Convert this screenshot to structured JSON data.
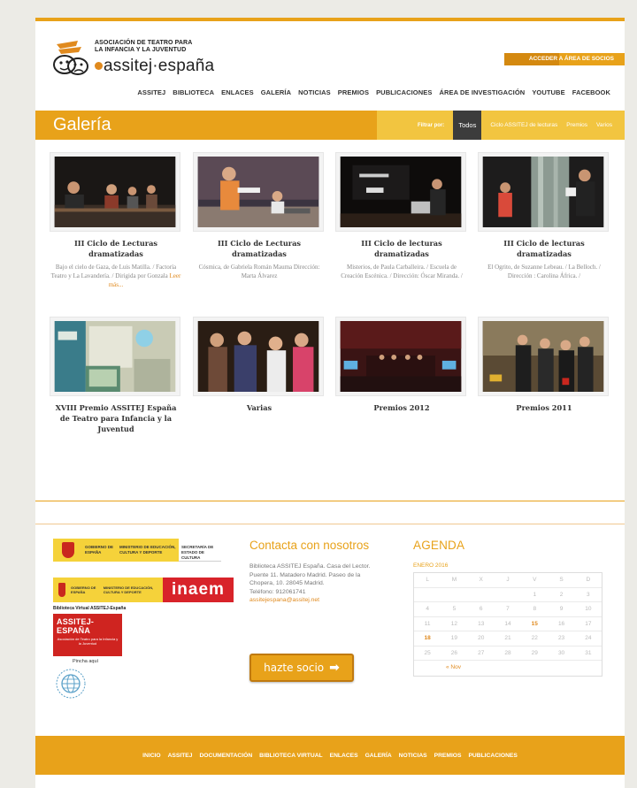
{
  "header": {
    "org_line1": "ASOCIACIÓN DE TEATRO PARA",
    "org_line2": "LA INFANCIA Y LA JUVENTUD",
    "brand": "assitej·españa",
    "members_button": "ACCEDER A ÁREA DE SOCIOS",
    "nav": [
      "ASSITEJ",
      "BIBLIOTECA",
      "ENLACES",
      "GALERÍA",
      "NOTICIAS",
      "PREMIOS",
      "PUBLICACIONES",
      "ÁREA DE INVESTIGACIÓN",
      "YOUTUBE",
      "FACEBOOK"
    ]
  },
  "gallery": {
    "title": "Galería",
    "filter_label": "Filtrar por:",
    "filters": [
      "Todos",
      "Ciclo ASSITEJ de lecturas",
      "Premios",
      "Varios"
    ],
    "active_filter": "Todos",
    "items": [
      {
        "title": "III Ciclo de Lecturas dramatizadas",
        "desc": "Bajo el cielo de Gaza, de Luis Matilla. / Factoría Teatro y La Lavandería. / Dirigida por Gonzala",
        "more": "Leer más..."
      },
      {
        "title": "III Ciclo de Lecturas dramatizadas",
        "desc": "Cósmica, de Gabriela Román Mauma Dirección: Marta Álvarez",
        "more": ""
      },
      {
        "title": "III Ciclo de lecturas dramatizadas",
        "desc": "Misterios, de Paula Carballeira. / Escuela de Creación Escénica. / Dirección: Óscar Miranda. /",
        "more": ""
      },
      {
        "title": "III Ciclo de lecturas dramatizadas",
        "desc": "El Ogrito, de Suzanne Lebeau. / La Belloch. / Dirección : Carolina África. /",
        "more": ""
      },
      {
        "title": "XVIII Premio ASSITEJ España de Teatro para Infancia y la Juventud",
        "desc": "",
        "more": ""
      },
      {
        "title": "Varias",
        "desc": "",
        "more": ""
      },
      {
        "title": "Premios 2012",
        "desc": "",
        "more": ""
      },
      {
        "title": "Premios 2011",
        "desc": "",
        "more": ""
      }
    ]
  },
  "logos": {
    "gob1": "GOBIERNO DE ESPAÑA",
    "min1": "MINISTERIO DE EDUCACIÓN, CULTURA Y DEPORTE",
    "sec": "SECRETARÍA DE ESTADO DE CULTURA",
    "gob2": "GOBIERNO DE ESPAÑA",
    "min2": "MINISTERIO DE EDUCACIÓN, CULTURA Y DEPORTE",
    "inaem": "inaem",
    "bv_title": "Biblioteca Virtual ASSITEJ-España",
    "bv_brand": "ASSITEJ-ESPAÑA",
    "bv_sub": "Asociación de Teatro para la Infancia y la Juventud",
    "bv_link": "Pincha aquí"
  },
  "contact": {
    "title": "Contacta con nosotros",
    "address": "Biblioteca ASSITEJ España. Casa del Lector. Puente 11. Matadero Madrid. Paseo de la Chopera, 10. 28045 Madrid.",
    "phone": "Teléfono: 912061741",
    "email": "assitejespana@assitej.net",
    "button": "hazte socio"
  },
  "agenda": {
    "title": "AGENDA",
    "month": "ENERO 2016",
    "weekdays": [
      "L",
      "M",
      "X",
      "J",
      "V",
      "S",
      "D"
    ],
    "weeks": [
      [
        "",
        "",
        "",
        "",
        "1",
        "2",
        "3"
      ],
      [
        "4",
        "5",
        "6",
        "7",
        "8",
        "9",
        "10"
      ],
      [
        "11",
        "12",
        "13",
        "14",
        "15",
        "16",
        "17"
      ],
      [
        "18",
        "19",
        "20",
        "21",
        "22",
        "23",
        "24"
      ],
      [
        "25",
        "26",
        "27",
        "28",
        "29",
        "30",
        "31"
      ]
    ],
    "prev": "« Nov"
  },
  "footer": {
    "nav": [
      "INICIO",
      "ASSITEJ",
      "DOCUMENTACIÓN",
      "BIBLIOTECA VIRTUAL",
      "ENLACES",
      "GALERÍA",
      "NOTICIAS",
      "PREMIOS",
      "PUBLICACIONES"
    ]
  }
}
